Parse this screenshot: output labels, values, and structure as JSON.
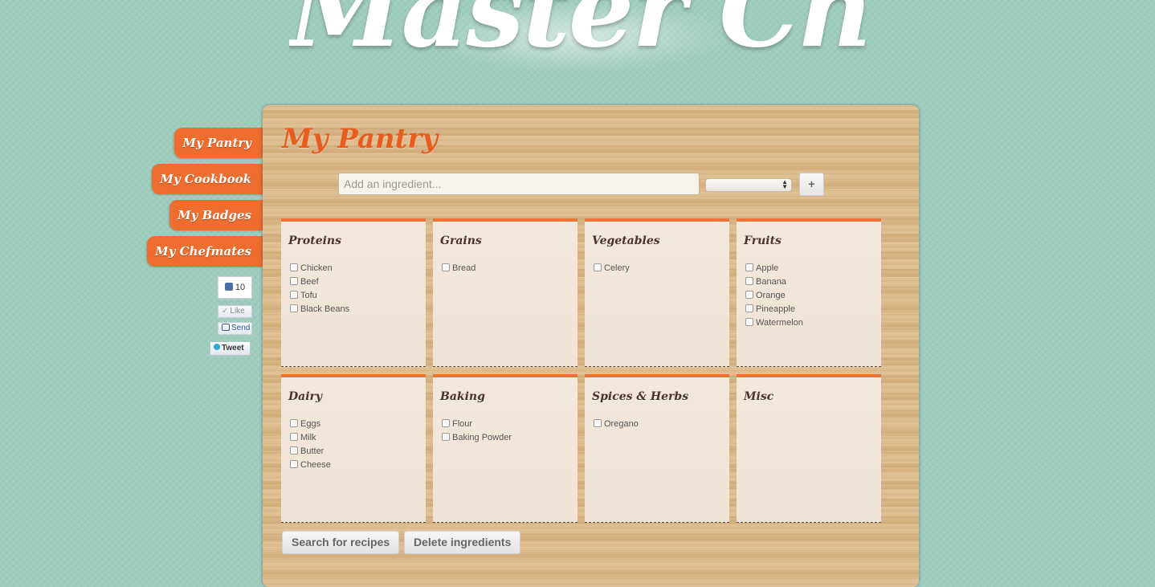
{
  "app": {
    "logo_text": "Master Chef"
  },
  "sidebar": {
    "items": [
      {
        "label": "My Pantry"
      },
      {
        "label": "My Cookbook"
      },
      {
        "label": "My Badges"
      },
      {
        "label": "My Chefmates"
      }
    ]
  },
  "social": {
    "like_count": "10",
    "like_label": "Like",
    "send_label": "Send",
    "tweet_label": "Tweet"
  },
  "pantry": {
    "title": "My Pantry",
    "input_placeholder": "Add an ingredient...",
    "category_selected": "",
    "add_label": "+",
    "categories": [
      {
        "name": "Proteins",
        "items": [
          "Chicken",
          "Beef",
          "Tofu",
          "Black Beans"
        ]
      },
      {
        "name": "Grains",
        "items": [
          "Bread"
        ]
      },
      {
        "name": "Vegetables",
        "items": [
          "Celery"
        ]
      },
      {
        "name": "Fruits",
        "items": [
          "Apple",
          "Banana",
          "Orange",
          "Pineapple",
          "Watermelon"
        ]
      },
      {
        "name": "Dairy",
        "items": [
          "Eggs",
          "Milk",
          "Butter",
          "Cheese"
        ]
      },
      {
        "name": "Baking",
        "items": [
          "Flour",
          "Baking Powder"
        ]
      },
      {
        "name": "Spices & Herbs",
        "items": [
          "Oregano"
        ]
      },
      {
        "name": "Misc",
        "items": []
      }
    ],
    "search_label": "Search for recipes",
    "delete_label": "Delete ingredients"
  },
  "colors": {
    "background": "#9fcdbd",
    "accent": "#ee6d2f",
    "title": "#e85d1e",
    "card": "#f3e8dc"
  }
}
